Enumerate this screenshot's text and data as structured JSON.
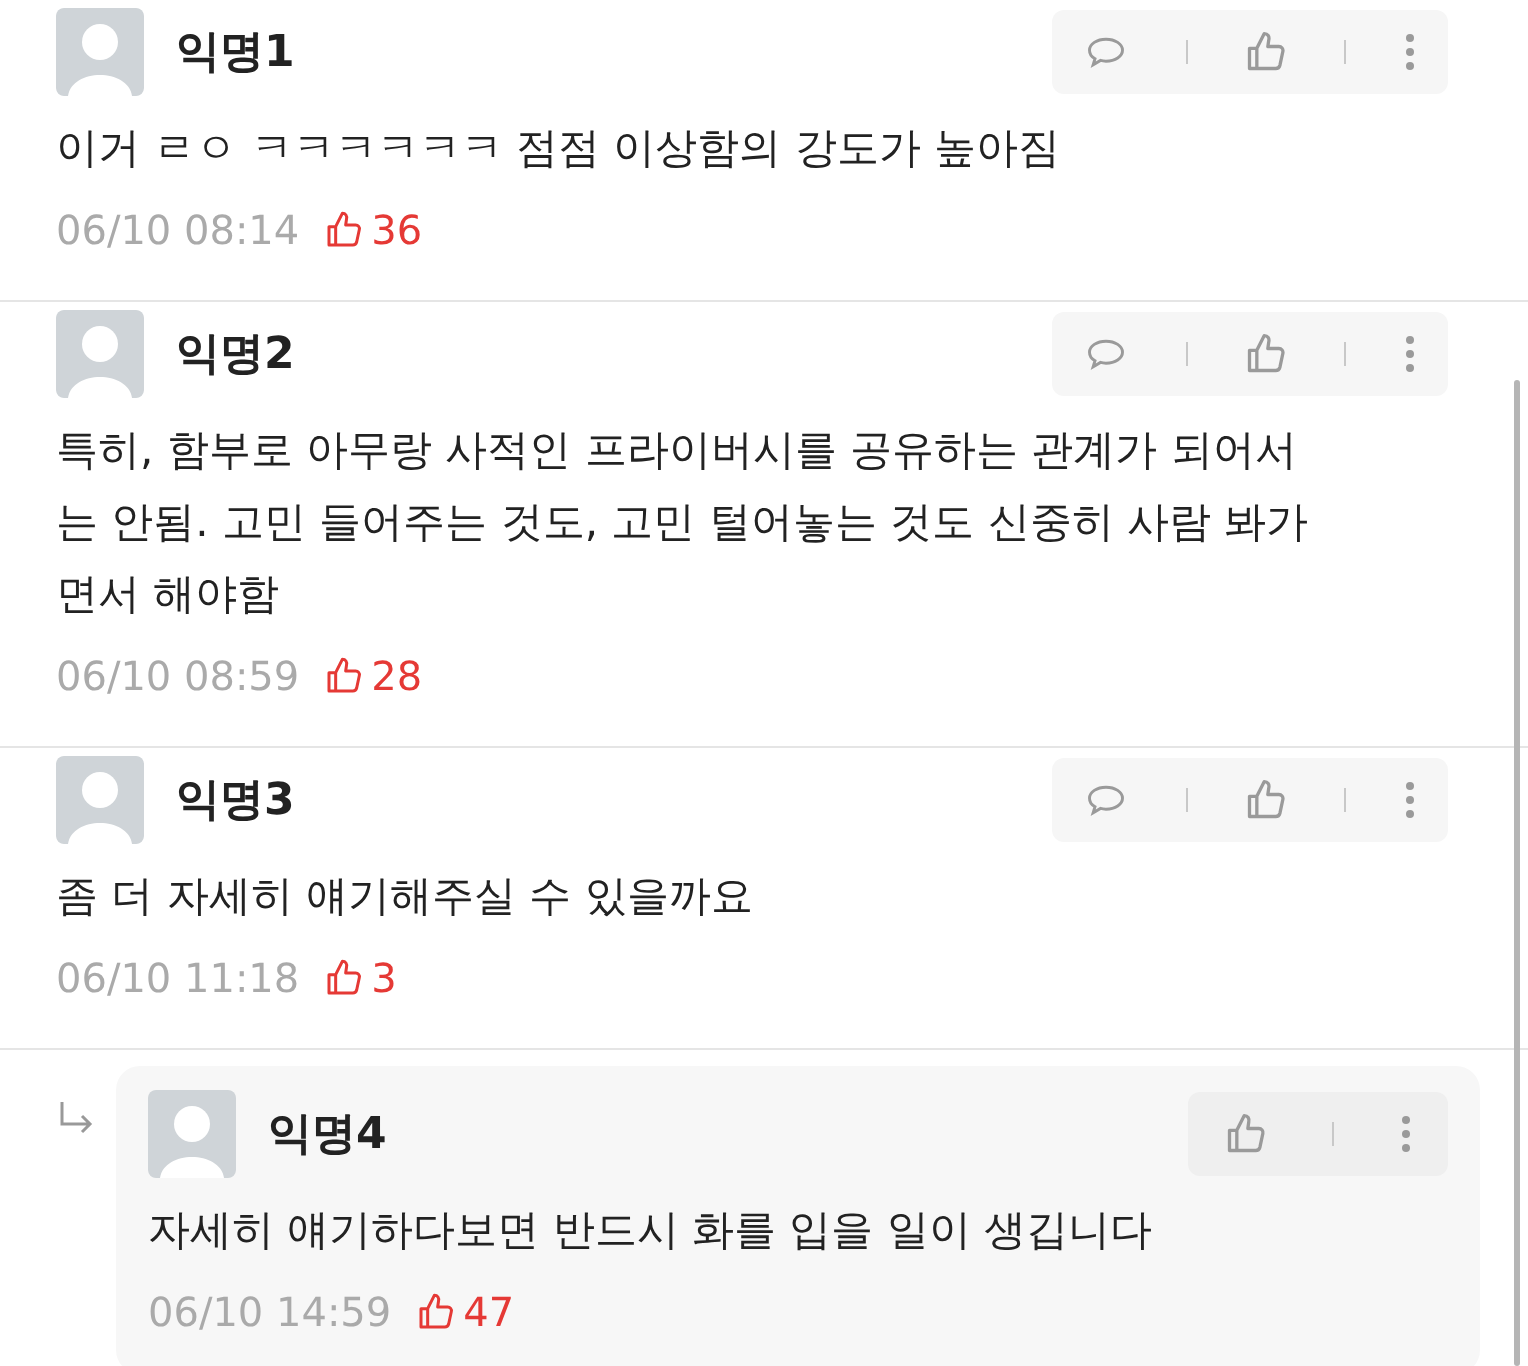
{
  "comments": [
    {
      "kind": "comment",
      "author": "익명1",
      "body": "이거 ㄹㅇ ㅋㅋㅋㅋㅋㅋ 점점 이상함의 강도가 높아짐",
      "time": "06/10 08:14",
      "likes": "36"
    },
    {
      "kind": "comment",
      "author": "익명2",
      "body": "특히, 함부로 아무랑 사적인 프라이버시를 공유하는 관계가 되어서는 안됨. 고민 들어주는 것도, 고민 털어놓는 것도 신중히 사람 봐가면서 해야함",
      "time": "06/10 08:59",
      "likes": "28"
    },
    {
      "kind": "comment",
      "author": "익명3",
      "body": "좀 더 자세히 얘기해주실 수 있을까요",
      "time": "06/10 11:18",
      "likes": "3"
    },
    {
      "kind": "reply",
      "author": "익명4",
      "body": "자세히 얘기하다보면 반드시 화를 입을 일이 생깁니다",
      "time": "06/10 14:59",
      "likes": "47"
    }
  ]
}
